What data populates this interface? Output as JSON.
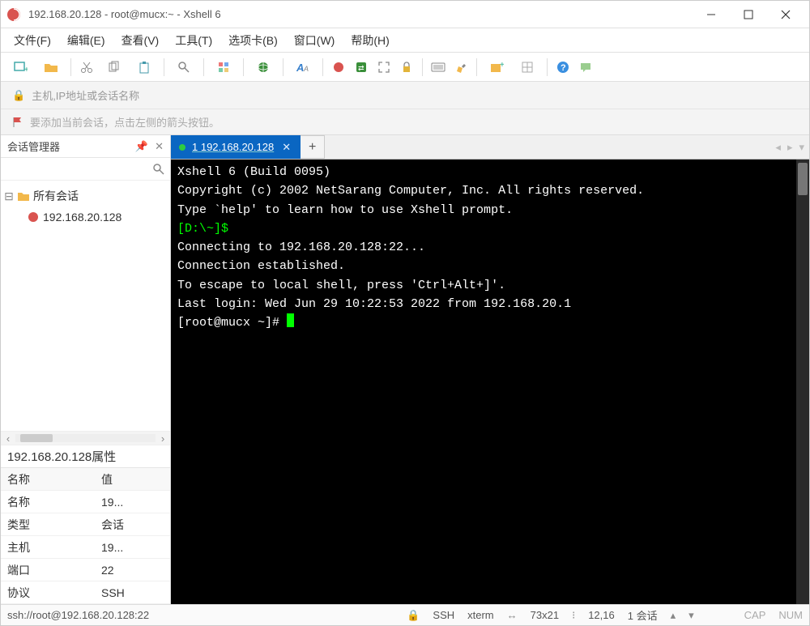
{
  "window": {
    "title": "192.168.20.128 - root@mucx:~ - Xshell 6"
  },
  "menu": {
    "file": "文件(F)",
    "edit": "编辑(E)",
    "view": "查看(V)",
    "tools": "工具(T)",
    "tabs": "选项卡(B)",
    "window": "窗口(W)",
    "help": "帮助(H)"
  },
  "addressbar": {
    "placeholder": "主机,IP地址或会话名称"
  },
  "hint": {
    "text": "要添加当前会话，点击左侧的箭头按钮。"
  },
  "side": {
    "title": "会话管理器",
    "tree_root": "所有会话",
    "tree_child": "192.168.20.128",
    "props_title": "192.168.20.128属性",
    "col_name": "名称",
    "col_value": "值",
    "rows": [
      {
        "k": "名称",
        "v": "19..."
      },
      {
        "k": "类型",
        "v": "会话"
      },
      {
        "k": "主机",
        "v": "19..."
      },
      {
        "k": "端口",
        "v": "22"
      },
      {
        "k": "协议",
        "v": "SSH"
      }
    ]
  },
  "tab": {
    "label": "1 192.168.20.128"
  },
  "terminal": {
    "l1": "Xshell 6 (Build 0095)",
    "l2": "Copyright (c) 2002 NetSarang Computer, Inc. All rights reserved.",
    "l3": "",
    "l4": "Type `help' to learn how to use Xshell prompt.",
    "l5a": "[D:\\~]$",
    "l6": "",
    "l7": "Connecting to 192.168.20.128:22...",
    "l8": "Connection established.",
    "l9": "To escape to local shell, press 'Ctrl+Alt+]'.",
    "l10": "",
    "l11": "Last login: Wed Jun 29 10:22:53 2022 from 192.168.20.1",
    "l12": "[root@mucx ~]# "
  },
  "status": {
    "conn": "ssh://root@192.168.20.128:22",
    "proto": "SSH",
    "term": "xterm",
    "size": "73x21",
    "pos": "12,16",
    "sess": "1 会话",
    "cap": "CAP",
    "num": "NUM"
  }
}
